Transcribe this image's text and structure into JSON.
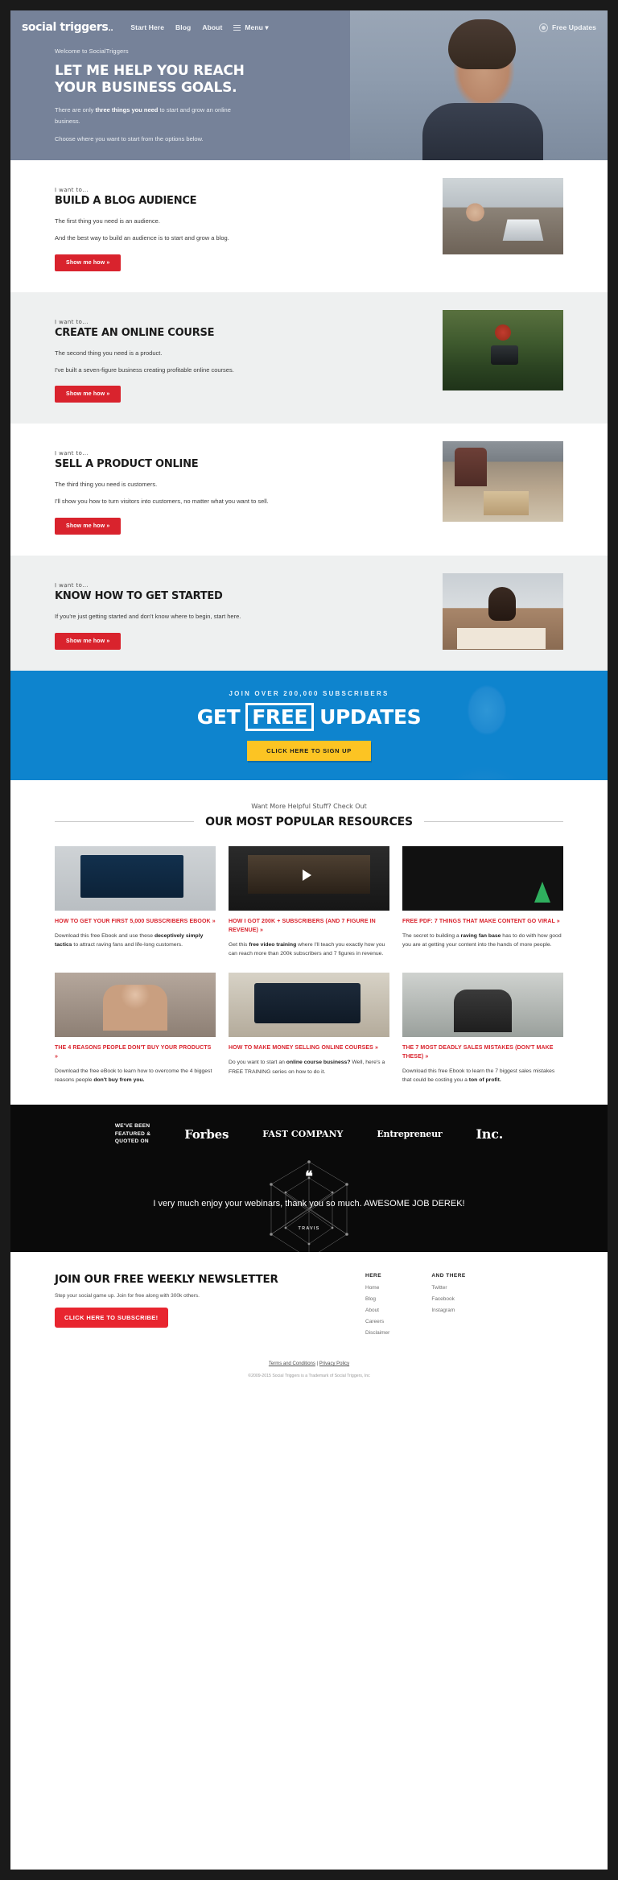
{
  "nav": {
    "logo": "social triggers",
    "logo_dot": "..",
    "links": [
      {
        "label": "Start Here"
      },
      {
        "label": "Blog"
      },
      {
        "label": "About"
      }
    ],
    "menu_label": "Menu ▾",
    "free_updates_label": "Free Updates"
  },
  "hero": {
    "eyebrow": "Welcome to SocialTriggers",
    "title": "LET ME HELP YOU REACH YOUR BUSINESS GOALS.",
    "body_1_pre": "There are only ",
    "body_1_bold": "three things you need",
    "body_1_post": " to start and grow an online business.",
    "body_2": "Choose where you want to start from the options below."
  },
  "sections": [
    {
      "eyebrow": "I want to...",
      "title": "BUILD A BLOG AUDIENCE",
      "p1": "The first thing you need is an audience.",
      "p2": "And the best way to build an audience is to start and grow a blog.",
      "button": "Show me how »",
      "image_name": "man-at-laptop-cafe-photo"
    },
    {
      "eyebrow": "I want to...",
      "title": "CREATE AN ONLINE COURSE",
      "p1": "The second thing you need is a product.",
      "p2": "I've built a seven-figure business creating profitable online courses.",
      "button": "Show me how »",
      "image_name": "woman-with-camera-photo"
    },
    {
      "eyebrow": "I want to...",
      "title": "SELL A PRODUCT ONLINE",
      "p1": "The third thing you need is customers.",
      "p2": "I'll show you how to turn visitors into customers, no matter what you want to sell.",
      "button": "Show me how »",
      "image_name": "workshop-packing-box-photo"
    },
    {
      "eyebrow": "I want to...",
      "title": "KNOW HOW TO GET STARTED",
      "p1": "If you're just getting started and don't know where to begin, start here.",
      "p2": "",
      "button": "Show me how »",
      "image_name": "frustrated-student-at-desk-photo"
    }
  ],
  "cta": {
    "kicker": "JOIN OVER 200,000 SUBSCRIBERS",
    "head_1": "GET",
    "head_boxed": "FREE",
    "head_2": "UPDATES",
    "button": "CLICK HERE TO SIGN UP",
    "bg_color": "#0e84ce",
    "button_color": "#fcc423"
  },
  "resources": {
    "kicker": "Want More Helpful Stuff? Check Out",
    "heading": "OUR MOST POPULAR RESOURCES",
    "cards": [
      {
        "title": "HOW TO GET YOUR FIRST 5,000 SUBSCRIBERS EBOOK »",
        "body_pre": "Download this free Ebook and use these ",
        "body_bold": "deceptively simply tactics",
        "body_post": " to attract raving fans and life-long customers.",
        "image_name": "ebook-5000-subscribers-cover"
      },
      {
        "title": "HOW I GOT 200K + SUBSCRIBERS (AND 7 FIGURE IN REVENUE) »",
        "body_pre": "Get this ",
        "body_bold": "free video training",
        "body_post": " where I'll teach you exactly how you can reach more than 200k subscribers and 7 figures in revenue.",
        "image_name": "video-training-play-thumbnail"
      },
      {
        "title": "FREE PDF: 7 THINGS THAT MAKE CONTENT GO VIRAL »",
        "body_pre": "The secret to building a ",
        "body_bold": "raving fan base",
        "body_post": " has to do with how good you are at getting your content into the hands of more people.",
        "image_name": "what-makes-things-go-viral-thumbnail"
      },
      {
        "title": "THE 4 REASONS PEOPLE DON'T BUY YOUR PRODUCTS »",
        "body_pre": "Download the free eBook to learn how to overcome the 4 biggest reasons people ",
        "body_bold": "don't buy from you.",
        "body_post": "",
        "image_name": "woman-portrait-thumbnail"
      },
      {
        "title": "HOW TO MAKE MONEY SELLING ONLINE COURSES »",
        "body_pre": "Do you want to start an ",
        "body_bold": "online course business?",
        "body_post": " Well, here's a FREE TRAINING series on how to do it.",
        "image_name": "tablet-in-hands-thumbnail"
      },
      {
        "title": "THE 7 MOST DEADLY SALES MISTAKES (DON'T MAKE THESE) »",
        "body_pre": "Download this free Ebook to learn the 7 biggest sales mistakes that could be costing you a ",
        "body_bold": "ton of profit.",
        "body_post": "",
        "image_name": "stressed-man-thumbnail"
      }
    ]
  },
  "proof": {
    "featured_line_1": "WE'VE BEEN",
    "featured_line_2": "FEATURED &",
    "featured_line_3": "QUOTED ON",
    "brands": [
      "Forbes",
      "FAST COMPANY",
      "Entrepreneur",
      "Inc."
    ],
    "quote_mark": "❝",
    "quote": "I very much enjoy your webinars, thank you so much. AWESOME JOB DEREK!",
    "author": "TRAVIS"
  },
  "footer": {
    "title": "JOIN OUR FREE WEEKLY NEWSLETTER",
    "subtitle": "Step your social game up. Join for free along with 300k others.",
    "button": "CLICK HERE TO SUBSCRIBE!",
    "columns": [
      {
        "heading": "HERE",
        "links": [
          "Home",
          "Blog",
          "About",
          "Careers",
          "Disclaimer"
        ]
      },
      {
        "heading": "AND THERE",
        "links": [
          "Twitter",
          "Facebook",
          "Instagram"
        ]
      }
    ],
    "terms_label": "Terms and Conditions",
    "separator": " | ",
    "privacy_label": "Privacy Policy",
    "copyright": "©2009-2015 Social Triggers is a Trademark of Social Triggers, Inc"
  }
}
